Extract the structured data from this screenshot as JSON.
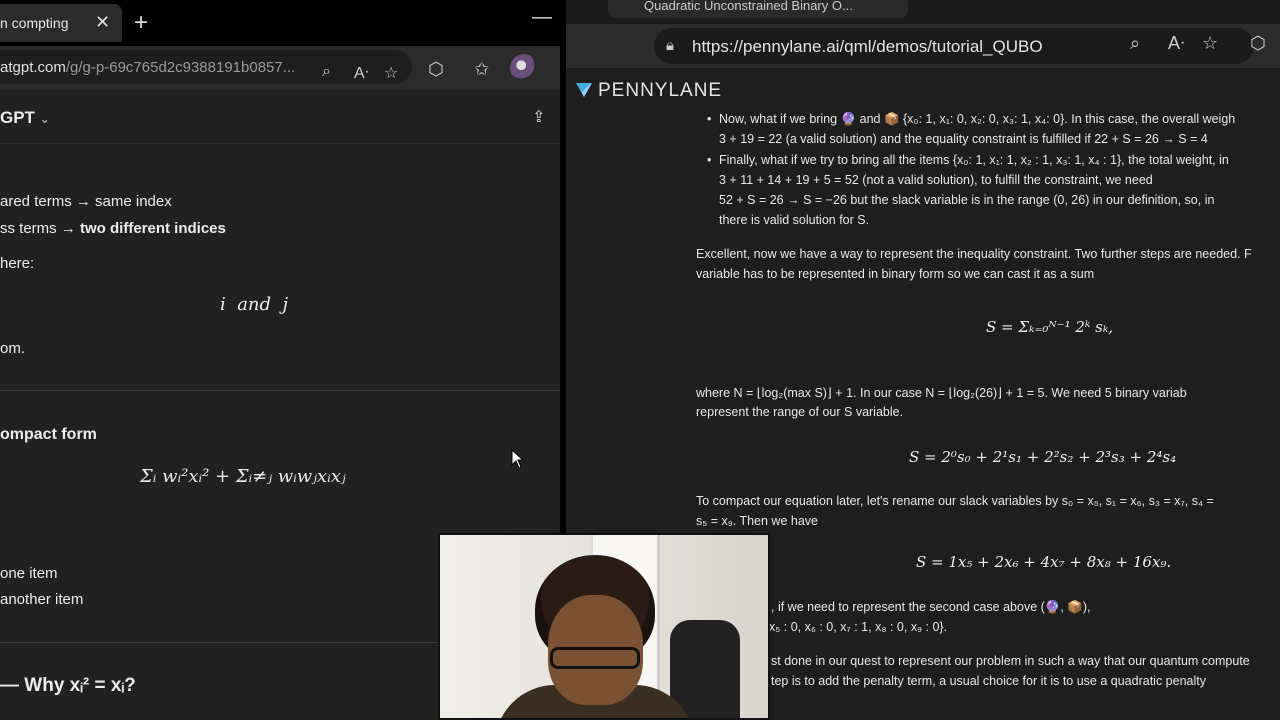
{
  "left": {
    "tab_title": "n compting",
    "url_host": "atgpt.com",
    "url_path": "/g/g-p-69c765d2c9388191b0857...",
    "app_name": "GPT",
    "lines": {
      "squared": "ared terms → same index",
      "cross_prefix": "ss terms → ",
      "cross_bold": "two different indices",
      "here": "here:",
      "i_and_j": "i  and  j",
      "om": "om.",
      "compact": "ompact form",
      "sum_expr": "Σᵢ wᵢ²xᵢ²  +  Σᵢ≠ⱼ wᵢwⱼxᵢxⱼ",
      "one_item": "one item",
      "another_item": "another item",
      "why": "— Why xᵢ² = xᵢ?"
    }
  },
  "right": {
    "tab_title": "Quadratic Unconstrained Binary O...",
    "url": "https://pennylane.ai/qml/demos/tutorial_QUBO",
    "brand": "PENNYLANE",
    "b1a": "Now, what if we bring 🔮 and 📦 {x₀: 1, x₁: 0, x₂: 0, x₃: 1, x₄: 0}. In this case, the overall weigh",
    "b1b": "3 + 19 = 22 (a valid solution) and the equality constraint is fulfilled if 22 + S = 26 → S = 4",
    "b2a": "Finally, what if we try to bring all the items {x₀: 1, x₁: 1, x₂ : 1, x₃: 1, x₄ : 1}, the total weight, in",
    "b2b": "3 + 11 + 14 + 19 + 5 = 52 (not a valid solution), to fulfill the constraint, we need",
    "b2c": "52 + S = 26 → S = −26 but the slack variable is in the range (0, 26) in our definition, so, in",
    "b2d": "there is valid solution for S.",
    "p1a": "Excellent, now we have a way to represent the inequality constraint. Two further steps are needed. F",
    "p1b": "variable has to be represented in binary form so we can cast it as a sum",
    "eq1": "S = Σₖ₌₀ᴺ⁻¹ 2ᵏ sₖ,",
    "p2a": "where N = ⌊log₂(max S)⌋ + 1. In our case N = ⌊log₂(26)⌋ + 1 = 5. We need 5 binary variab",
    "p2b": "represent the range of our S variable.",
    "eq2": "S = 2⁰s₀ + 2¹s₁ + 2²s₂ + 2³s₃ + 2⁴s₄",
    "p3a": "To compact our equation later, let's rename our slack variables by s₀ = x₅, s₁ = x₆, s₃ = x₇, s₄ =",
    "p3b": "s₅ = x₉. Then we have",
    "eq3": "S = 1x₅ + 2x₆ + 4x₇ + 8x₈ + 16x₉.",
    "p4a": ", if we need to represent the second case above (🔮, 📦),",
    "p4b": "x₅ : 0, x₆ : 0, x₇ : 1, x₈ : 0, x₉ : 0}.",
    "p5a": "st done in our quest to represent our problem in such a way that our quantum compute",
    "p5b": "tep is to add the penalty term, a usual choice for it is to use a quadratic penalty"
  }
}
